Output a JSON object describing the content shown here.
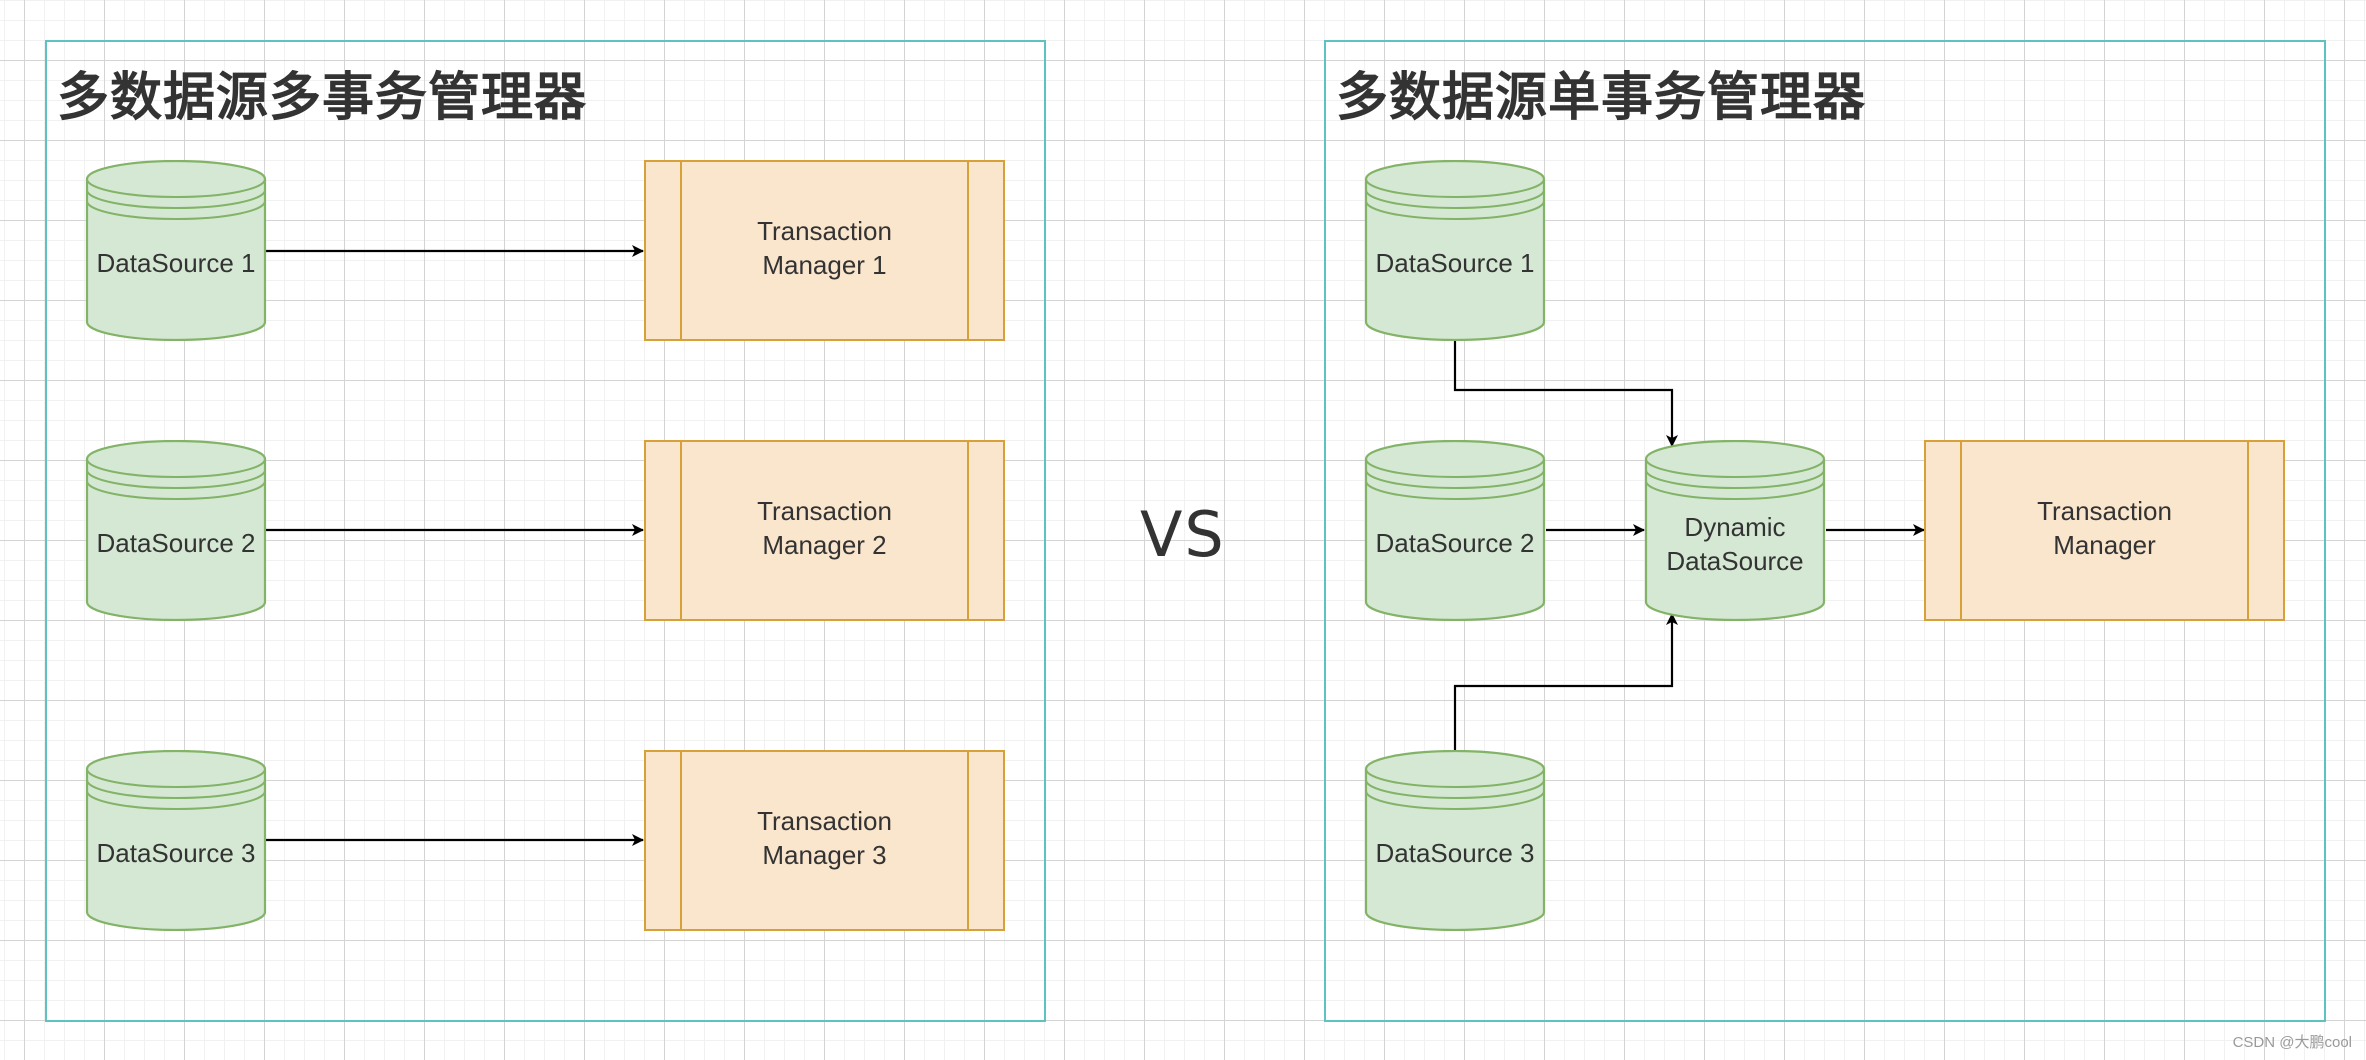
{
  "left_panel": {
    "title": "多数据源多事务管理器",
    "datasources": [
      "DataSource 1",
      "DataSource 2",
      "DataSource 3"
    ],
    "managers": [
      {
        "line1": "Transaction",
        "line2": "Manager 1"
      },
      {
        "line1": "Transaction",
        "line2": "Manager 2"
      },
      {
        "line1": "Transaction",
        "line2": "Manager 3"
      }
    ]
  },
  "separator": "VS",
  "right_panel": {
    "title": "多数据源单事务管理器",
    "datasources": [
      "DataSource 1",
      "DataSource 2",
      "DataSource 3"
    ],
    "dynamic": {
      "line1": "Dynamic",
      "line2": "DataSource"
    },
    "manager": {
      "line1": "Transaction",
      "line2": "Manager"
    }
  },
  "edges": [
    {
      "from": "left.DataSource 1",
      "to": "left.Transaction Manager 1"
    },
    {
      "from": "left.DataSource 2",
      "to": "left.Transaction Manager 2"
    },
    {
      "from": "left.DataSource 3",
      "to": "left.Transaction Manager 3"
    },
    {
      "from": "right.DataSource 1",
      "to": "right.Dynamic DataSource"
    },
    {
      "from": "right.DataSource 2",
      "to": "right.Dynamic DataSource"
    },
    {
      "from": "right.DataSource 3",
      "to": "right.Dynamic DataSource"
    },
    {
      "from": "right.Dynamic DataSource",
      "to": "right.Transaction Manager"
    }
  ],
  "colors": {
    "panel_border": "#5ec2c2",
    "datasource_fill": "#d5e8d4",
    "datasource_stroke": "#82b366",
    "manager_fill": "#fae5cd",
    "manager_stroke": "#d5a138",
    "text": "#333333"
  },
  "watermark": "CSDN @大鹏cool"
}
